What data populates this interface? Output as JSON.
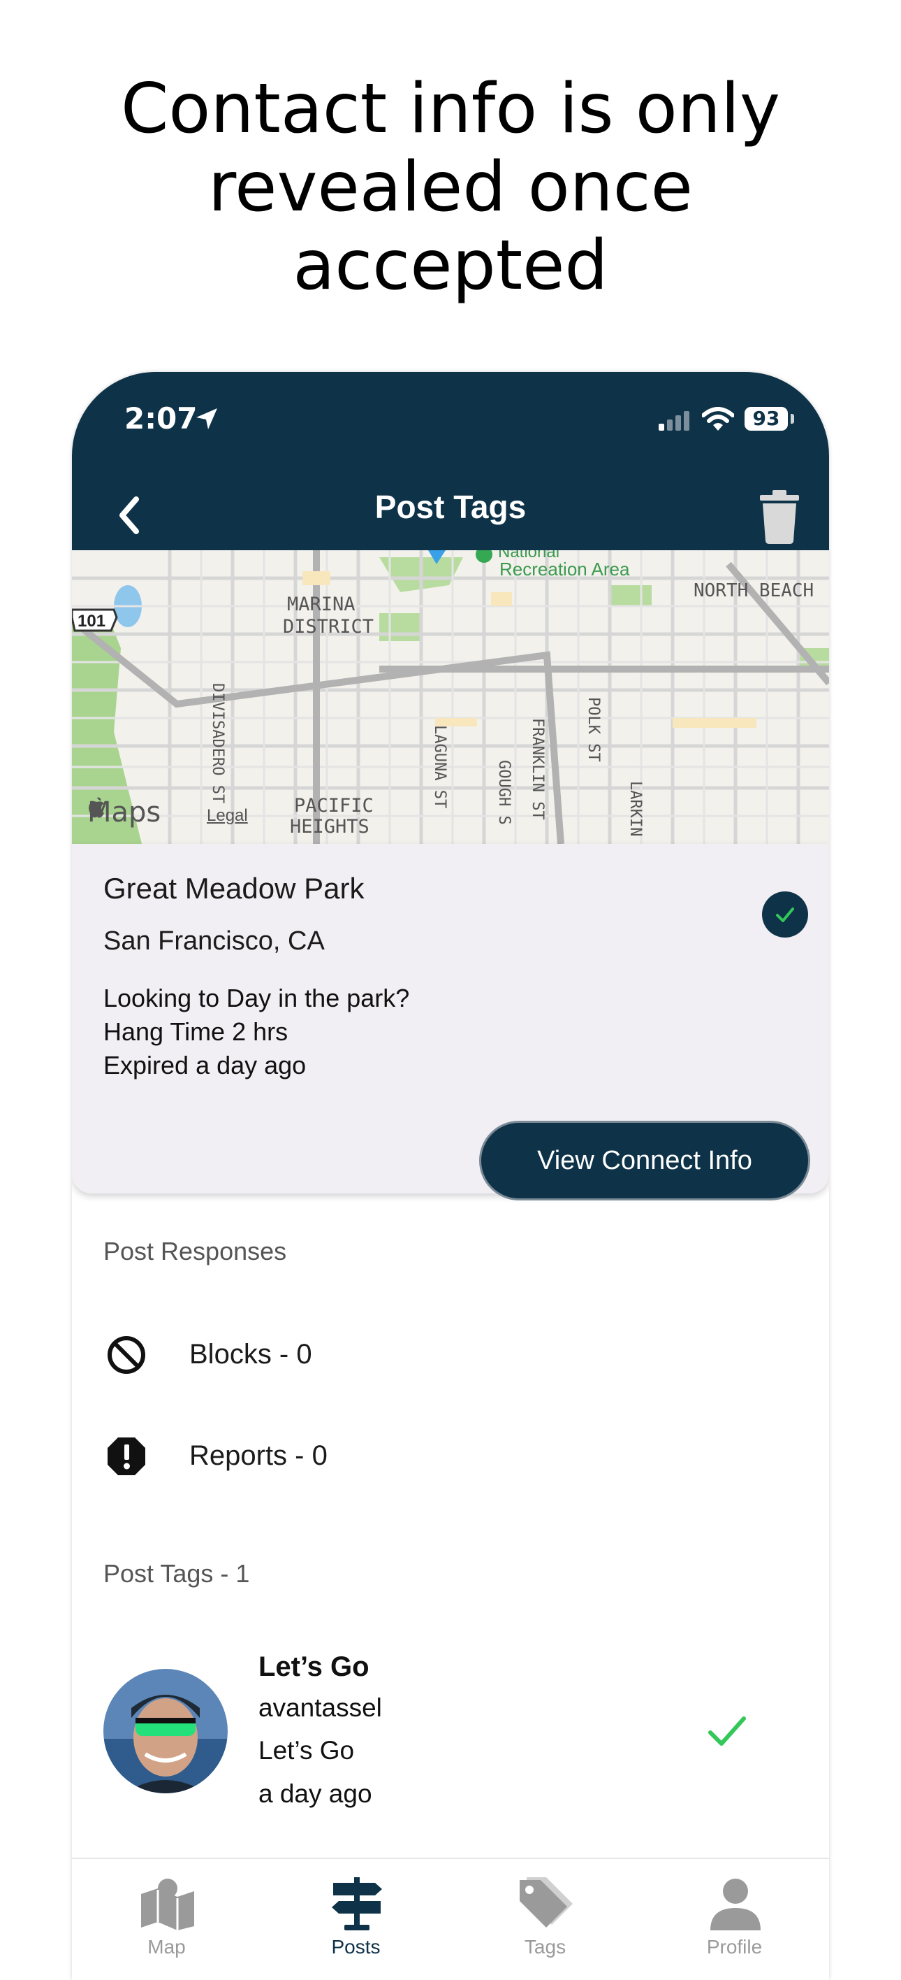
{
  "headline": {
    "lines": [
      "Contact info is only",
      "revealed once",
      "accepted"
    ]
  },
  "status_bar": {
    "time": "2:07",
    "battery": "93"
  },
  "nav": {
    "title": "Post Tags",
    "back_icon": "chevron-left-icon",
    "delete_icon": "trash-icon"
  },
  "map": {
    "labels": {
      "national": "National",
      "recreation_area": "Recreation Area",
      "north_beach": "NORTH BEACH",
      "marina": "MARINA",
      "district": "DISTRICT",
      "highway": "101",
      "divisadero": "DIVISADERO ST",
      "laguna": "LAGUNA ST",
      "gough": "GOUGH S",
      "franklin": "FRANKLIN ST",
      "polk": "POLK ST",
      "larkin": "LARKIN",
      "pacific": "PACIFIC",
      "heights": "HEIGHTS"
    },
    "maps_logo": "Maps",
    "legal": "Legal"
  },
  "post": {
    "title": "Great Meadow Park",
    "location": "San Francisco, CA",
    "line1": "Looking to Day in the park?",
    "line2": "Hang Time 2 hrs",
    "line3": "Expired a day ago",
    "connect_button": "View Connect Info"
  },
  "responses": {
    "heading": "Post Responses",
    "blocks": "Blocks - 0",
    "reports": "Reports - 0"
  },
  "tags": {
    "heading": "Post Tags - 1",
    "items": [
      {
        "name": "Let’s Go",
        "username": "avantassel",
        "message": "Let’s Go",
        "time": "a day ago"
      }
    ]
  },
  "tab_bar": {
    "items": [
      {
        "label": "Map",
        "icon": "map-icon"
      },
      {
        "label": "Posts",
        "icon": "signpost-icon"
      },
      {
        "label": "Tags",
        "icon": "tags-icon"
      },
      {
        "label": "Profile",
        "icon": "profile-icon"
      }
    ],
    "active": "Posts"
  },
  "colors": {
    "primary": "#0e3248",
    "check_green": "#34c759",
    "card_bg": "#f1eff4",
    "tab_inactive": "#9a9a9a"
  }
}
